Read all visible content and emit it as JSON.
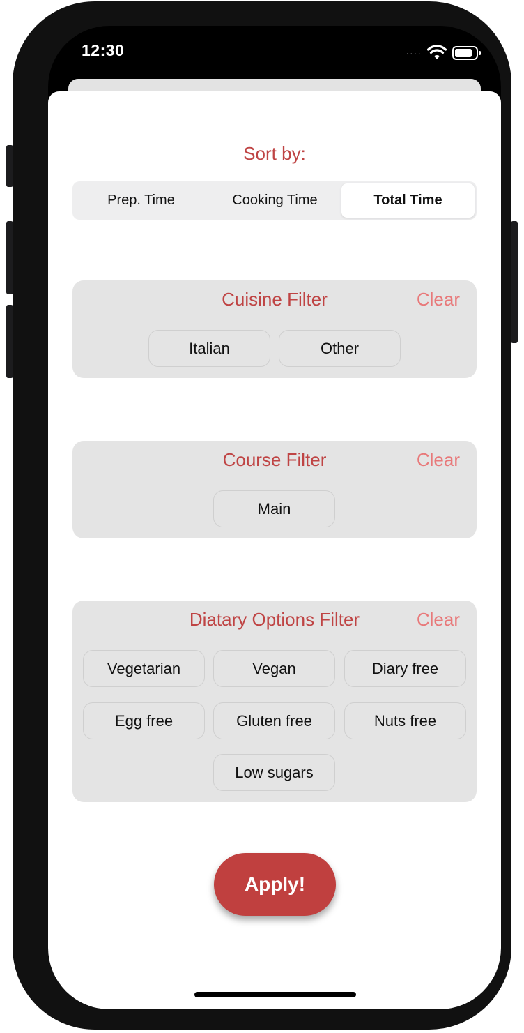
{
  "status_bar": {
    "time": "12:30",
    "signal_icon": "cellular-dots-icon",
    "wifi_icon": "wifi-icon",
    "battery_icon": "battery-icon"
  },
  "sort": {
    "title": "Sort by:",
    "options": [
      "Prep. Time",
      "Cooking Time",
      "Total Time"
    ],
    "selected": "Total Time"
  },
  "cuisine_filter": {
    "title": "Cuisine Filter",
    "clear_label": "Clear",
    "options": [
      "Italian",
      "Other"
    ]
  },
  "course_filter": {
    "title": "Course Filter",
    "clear_label": "Clear",
    "options": [
      "Main"
    ]
  },
  "dietary_filter": {
    "title": "Diatary Options Filter",
    "clear_label": "Clear",
    "options": [
      "Vegetarian",
      "Vegan",
      "Diary free",
      "Egg free",
      "Gluten free",
      "Nuts free",
      "Low sugars"
    ]
  },
  "apply_label": "Apply!",
  "colors": {
    "accent": "#bf4444",
    "clear": "#e8797a",
    "apply": "#c0403f",
    "card": "#e4e4e4"
  }
}
